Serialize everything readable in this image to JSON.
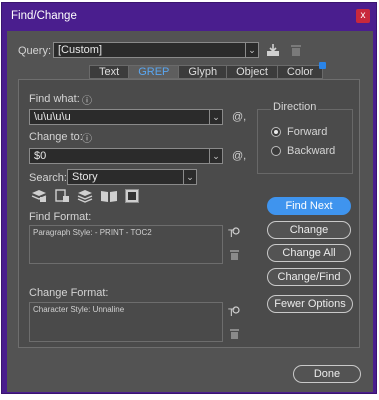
{
  "window": {
    "title": "Find/Change",
    "close": "x"
  },
  "query": {
    "label": "Query:",
    "value": "[Custom]"
  },
  "tabs": [
    {
      "label": "Text"
    },
    {
      "label": "GREP"
    },
    {
      "label": "Glyph"
    },
    {
      "label": "Object"
    },
    {
      "label": "Color"
    }
  ],
  "find_what": {
    "label": "Find what:",
    "value": "\\u\\u\\u\\u",
    "info": "ⓘ"
  },
  "change_to": {
    "label": "Change to:",
    "value": "$0",
    "info": "ⓘ"
  },
  "search": {
    "label": "Search:",
    "value": "Story"
  },
  "find_format": {
    "label": "Find Format:",
    "value": "Paragraph Style: - PRINT - TOC2"
  },
  "change_format": {
    "label": "Change Format:",
    "value": "Character Style: Unnaline"
  },
  "direction": {
    "label": "Direction",
    "options": [
      {
        "label": "Forward",
        "selected": true
      },
      {
        "label": "Backward",
        "selected": false
      }
    ]
  },
  "buttons": {
    "find_next": "Find Next",
    "change": "Change",
    "change_all": "Change All",
    "change_find": "Change/Find",
    "fewer_options": "Fewer Options",
    "done": "Done"
  },
  "icons": {
    "special_chars": "@,",
    "dropdown": "⌄"
  },
  "colors": {
    "titlebar": "#4a1e8e",
    "dialog_bg": "#535353",
    "accent": "#3f94ee",
    "close": "#c8283c"
  }
}
